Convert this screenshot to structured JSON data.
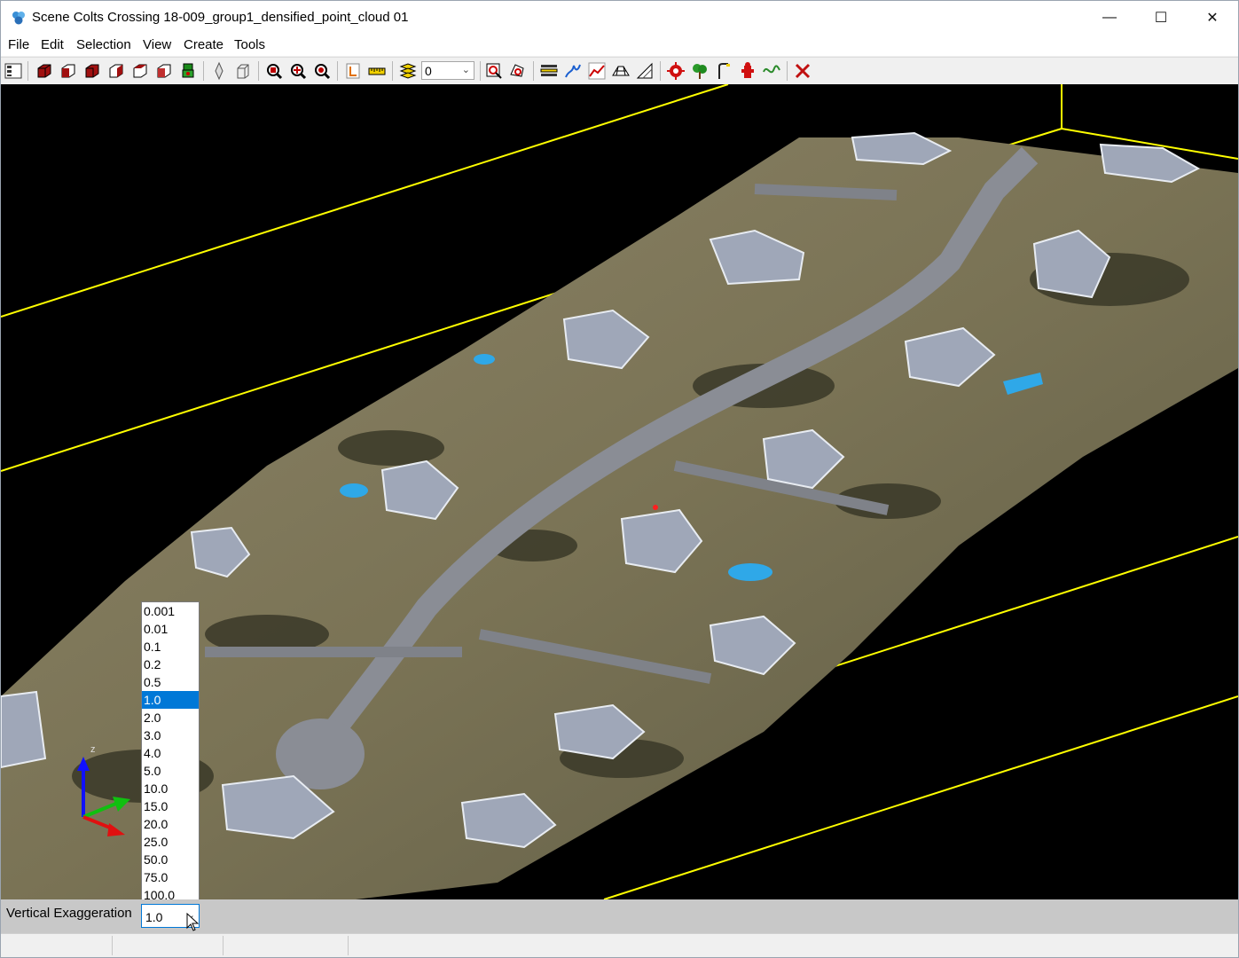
{
  "window": {
    "title": "Scene Colts Crossing 18-009_group1_densified_point_cloud 01",
    "controls": {
      "minimize": "—",
      "maximize": "☐",
      "close": "✕"
    }
  },
  "menu": [
    "File",
    "Edit",
    "Selection",
    "View",
    "Create",
    "Tools"
  ],
  "toolbar": {
    "icons": [
      "scene-tree-icon",
      "view-top-icon",
      "view-front-icon",
      "view-right-icon",
      "view-back-icon",
      "view-left-icon",
      "view-iso-icon",
      "robot-view-icon",
      "orbit-icon",
      "pan-icon",
      "zoom-window-icon",
      "zoom-extents-icon",
      "zoom-target-icon",
      "measure-point-icon",
      "measure-ruler-icon",
      "layers-icon",
      "select-window-icon",
      "select-polygon-icon",
      "profile-icon",
      "contour-icon",
      "cross-section-icon",
      "surface-icon",
      "slope-icon",
      "target-icon",
      "tree-icon",
      "pole-icon",
      "hydrant-icon",
      "line-icon",
      "delete-icon"
    ],
    "layer_combo_value": "0"
  },
  "vertical_exaggeration": {
    "label": "Vertical Exaggeration",
    "value": "1.0",
    "options": [
      "0.001",
      "0.01",
      "0.1",
      "0.2",
      "0.5",
      "1.0",
      "2.0",
      "3.0",
      "4.0",
      "5.0",
      "10.0",
      "15.0",
      "20.0",
      "25.0",
      "50.0",
      "75.0",
      "100.0"
    ],
    "selected_index": 5
  },
  "gizmo": {
    "z_label": "z"
  },
  "colors": {
    "bounding_box": "#ffff00",
    "selection": "#0078d7",
    "viewport_bg": "#000000"
  }
}
